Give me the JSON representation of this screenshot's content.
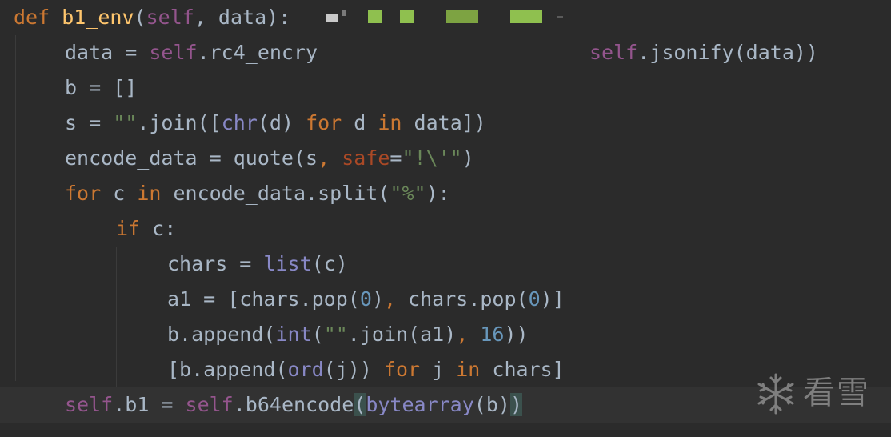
{
  "code_lines": [
    {
      "tokens": [
        {
          "t": "def ",
          "c": "kw"
        },
        {
          "t": "b1_env",
          "c": "fn"
        },
        {
          "t": "(",
          "c": "plain"
        },
        {
          "t": "self",
          "c": "self"
        },
        {
          "t": ", data):",
          "c": "plain"
        }
      ]
    },
    {
      "tokens": [
        {
          "t": "data = ",
          "c": "plain"
        },
        {
          "t": "self",
          "c": "self"
        },
        {
          "t": ".rc4_encry",
          "c": "plain"
        }
      ]
    },
    {
      "tokens": [
        {
          "t": "b = []",
          "c": "plain"
        }
      ]
    },
    {
      "tokens": [
        {
          "t": "s = ",
          "c": "plain"
        },
        {
          "t": "\"\"",
          "c": "str"
        },
        {
          "t": ".join([",
          "c": "plain"
        },
        {
          "t": "chr",
          "c": "builtin"
        },
        {
          "t": "(d) ",
          "c": "plain"
        },
        {
          "t": "for",
          "c": "kw"
        },
        {
          "t": " d ",
          "c": "plain"
        },
        {
          "t": "in",
          "c": "kw"
        },
        {
          "t": " data])",
          "c": "plain"
        }
      ]
    },
    {
      "tokens": [
        {
          "t": "encode_data = quote(s",
          "c": "plain"
        },
        {
          "t": ", ",
          "c": "kw"
        },
        {
          "t": "safe",
          "c": "kwarg"
        },
        {
          "t": "=",
          "c": "plain"
        },
        {
          "t": "\"!\\'\"",
          "c": "str"
        },
        {
          "t": ")",
          "c": "plain"
        }
      ]
    },
    {
      "tokens": [
        {
          "t": "for",
          "c": "kw"
        },
        {
          "t": " c ",
          "c": "plain"
        },
        {
          "t": "in",
          "c": "kw"
        },
        {
          "t": " encode_data.split(",
          "c": "plain"
        },
        {
          "t": "\"%\"",
          "c": "str"
        },
        {
          "t": "):",
          "c": "plain"
        }
      ]
    },
    {
      "tokens": [
        {
          "t": "if",
          "c": "kw"
        },
        {
          "t": " c:",
          "c": "plain"
        }
      ]
    },
    {
      "tokens": [
        {
          "t": "chars = ",
          "c": "plain"
        },
        {
          "t": "list",
          "c": "builtin"
        },
        {
          "t": "(c)",
          "c": "plain"
        }
      ]
    },
    {
      "tokens": [
        {
          "t": "a1 = [chars.pop(",
          "c": "plain"
        },
        {
          "t": "0",
          "c": "num"
        },
        {
          "t": ")",
          "c": "plain"
        },
        {
          "t": ", ",
          "c": "kw"
        },
        {
          "t": "chars.pop(",
          "c": "plain"
        },
        {
          "t": "0",
          "c": "num"
        },
        {
          "t": ")]",
          "c": "plain"
        }
      ]
    },
    {
      "tokens": [
        {
          "t": "b.append(",
          "c": "plain"
        },
        {
          "t": "int",
          "c": "builtin"
        },
        {
          "t": "(",
          "c": "plain"
        },
        {
          "t": "\"\"",
          "c": "str"
        },
        {
          "t": ".join(a1)",
          "c": "plain"
        },
        {
          "t": ", ",
          "c": "kw"
        },
        {
          "t": "16",
          "c": "num"
        },
        {
          "t": "))",
          "c": "plain"
        }
      ]
    },
    {
      "tokens": [
        {
          "t": "[b.append(",
          "c": "plain"
        },
        {
          "t": "ord",
          "c": "builtin"
        },
        {
          "t": "(j)) ",
          "c": "plain"
        },
        {
          "t": "for",
          "c": "kw"
        },
        {
          "t": " j ",
          "c": "plain"
        },
        {
          "t": "in",
          "c": "kw"
        },
        {
          "t": " chars]",
          "c": "plain"
        }
      ]
    },
    {
      "tokens": [
        {
          "t": "self",
          "c": "self"
        },
        {
          "t": ".b1 = ",
          "c": "plain"
        },
        {
          "t": "self",
          "c": "self"
        },
        {
          "t": ".b64encode",
          "c": "plain"
        },
        {
          "t": "(",
          "c": "plain",
          "hl": true
        },
        {
          "t": "bytearray",
          "c": "builtin"
        },
        {
          "t": "(b)",
          "c": "plain"
        },
        {
          "t": ")",
          "c": "plain",
          "hl": true
        }
      ]
    }
  ],
  "line2_tail": [
    {
      "t": "self",
      "c": "self"
    },
    {
      "t": ".jsonify(data))",
      "c": "plain"
    }
  ],
  "colors": {
    "background": "#2b2b2b",
    "keyword": "#cc7832",
    "function": "#ffc66d",
    "self": "#94558d",
    "string": "#6a8759",
    "number": "#6897bb",
    "builtin": "#8888c6",
    "kwarg": "#aa4926",
    "text": "#a9b7c6",
    "redaction": "#8fc04f"
  },
  "watermark": {
    "icon": "snowflake-icon",
    "text": "看雪"
  }
}
